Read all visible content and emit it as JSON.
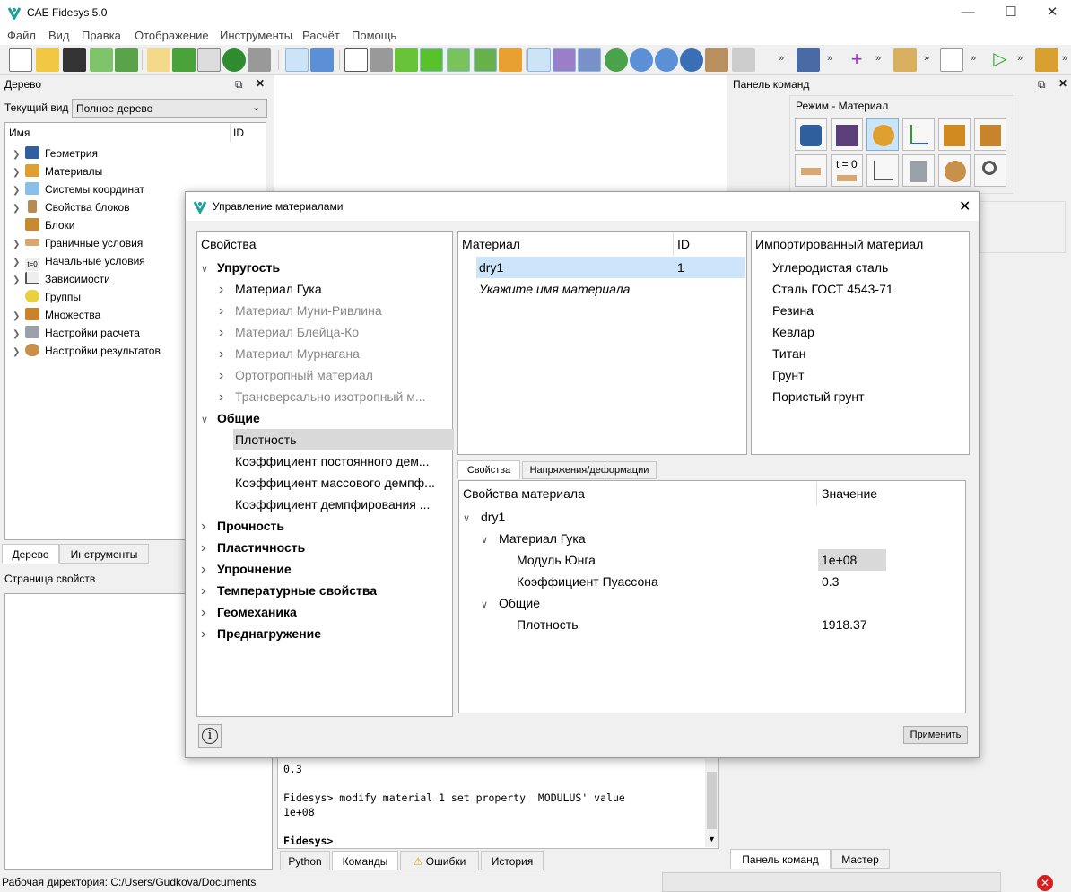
{
  "app": {
    "title": "CAE Fidesys 5.0"
  },
  "menu": [
    "Файл",
    "Вид",
    "Правка",
    "Отображение",
    "Инструменты",
    "Расчёт",
    "Помощь"
  ],
  "tree_panel": {
    "title": "Дерево",
    "view_label": "Текущий вид",
    "view_value": "Полное дерево",
    "col_name": "Имя",
    "col_id": "ID",
    "items": [
      "Геометрия",
      "Материалы",
      "Системы координат",
      "Свойства блоков",
      "Блоки",
      "Граничные условия",
      "Начальные условия",
      "Зависимости",
      "Группы",
      "Множества",
      "Настройки расчета",
      "Настройки результатов"
    ],
    "tabs": [
      "Дерево",
      "Инструменты"
    ],
    "properties_title": "Страница свойств"
  },
  "command_panel": {
    "title": "Панель команд",
    "mode": "Режим - Материал",
    "t0_label": "t = 0",
    "tabs": [
      "Панель команд",
      "Мастер"
    ]
  },
  "console": {
    "lines": [
      "0.3",
      "",
      "Fidesys> modify material 1 set property 'MODULUS' value",
      "1e+08",
      "",
      "Fidesys>"
    ],
    "tabs": [
      "Python",
      "Команды",
      "Ошибки",
      "История"
    ]
  },
  "status": {
    "workdir": "Рабочая директория: C:/Users/Gudkova/Documents"
  },
  "dialog": {
    "title": "Управление материалами",
    "props_header": "Свойства",
    "props": [
      {
        "label": "Упругость",
        "level": 0,
        "style": "bold",
        "arrow": "down"
      },
      {
        "label": "Материал Гука",
        "level": 1,
        "style": "normal",
        "arrow": "right"
      },
      {
        "label": "Материал Муни-Ривлина",
        "level": 1,
        "style": "grey",
        "arrow": "right"
      },
      {
        "label": "Материал Блейца-Ко",
        "level": 1,
        "style": "grey",
        "arrow": "right"
      },
      {
        "label": "Материал Мурнагана",
        "level": 1,
        "style": "grey",
        "arrow": "right"
      },
      {
        "label": "Ортотропный материал",
        "level": 1,
        "style": "grey",
        "arrow": "right"
      },
      {
        "label": "Трансверсально изотропный м...",
        "level": 1,
        "style": "grey",
        "arrow": "right"
      },
      {
        "label": "Общие",
        "level": 0,
        "style": "bold",
        "arrow": "down"
      },
      {
        "label": "Плотность",
        "level": 1,
        "style": "normal",
        "arrow": "",
        "selected": true
      },
      {
        "label": "Коэффициент постоянного дем...",
        "level": 1,
        "style": "normal",
        "arrow": ""
      },
      {
        "label": "Коэффициент массового демпф...",
        "level": 1,
        "style": "normal",
        "arrow": ""
      },
      {
        "label": "Коэффициент демпфирования ...",
        "level": 1,
        "style": "normal",
        "arrow": ""
      },
      {
        "label": "Прочность",
        "level": 0,
        "style": "bold",
        "arrow": "right"
      },
      {
        "label": "Пластичность",
        "level": 0,
        "style": "bold",
        "arrow": "right"
      },
      {
        "label": "Упрочнение",
        "level": 0,
        "style": "bold",
        "arrow": "right"
      },
      {
        "label": "Температурные свойства",
        "level": 0,
        "style": "bold",
        "arrow": "right"
      },
      {
        "label": "Геомеханика",
        "level": 0,
        "style": "bold",
        "arrow": "right"
      },
      {
        "label": "Преднагружение",
        "level": 0,
        "style": "bold",
        "arrow": "right"
      }
    ],
    "materials_header": "Материал",
    "materials_id_header": "ID",
    "materials": [
      {
        "name": "dry1",
        "id": "1"
      }
    ],
    "materials_placeholder": "Укажите имя материала",
    "imported_header": "Импортированный материал",
    "imported": [
      "Углеродистая сталь",
      "Сталь ГОСТ 4543-71",
      "Резина",
      "Кевлар",
      "Титан",
      "Грунт",
      "Пористый грунт"
    ],
    "tabs": [
      "Свойства",
      "Напряжения/деформации"
    ],
    "mat_props_header": "Свойства материала",
    "mat_value_header": "Значение",
    "mat_props": [
      {
        "label": "dry1",
        "value": "",
        "level": 0,
        "arrow": "down"
      },
      {
        "label": "Материал Гука",
        "value": "",
        "level": 1,
        "arrow": "down"
      },
      {
        "label": "Модуль Юнга",
        "value": "1e+08",
        "level": 2,
        "arrow": "",
        "hl": true
      },
      {
        "label": "Коэффициент Пуассона",
        "value": "0.3",
        "level": 2,
        "arrow": ""
      },
      {
        "label": "Общие",
        "value": "",
        "level": 1,
        "arrow": "down"
      },
      {
        "label": "Плотность",
        "value": "1918.37",
        "level": 2,
        "arrow": ""
      }
    ],
    "apply": "Применить",
    "info_icon": "i"
  }
}
